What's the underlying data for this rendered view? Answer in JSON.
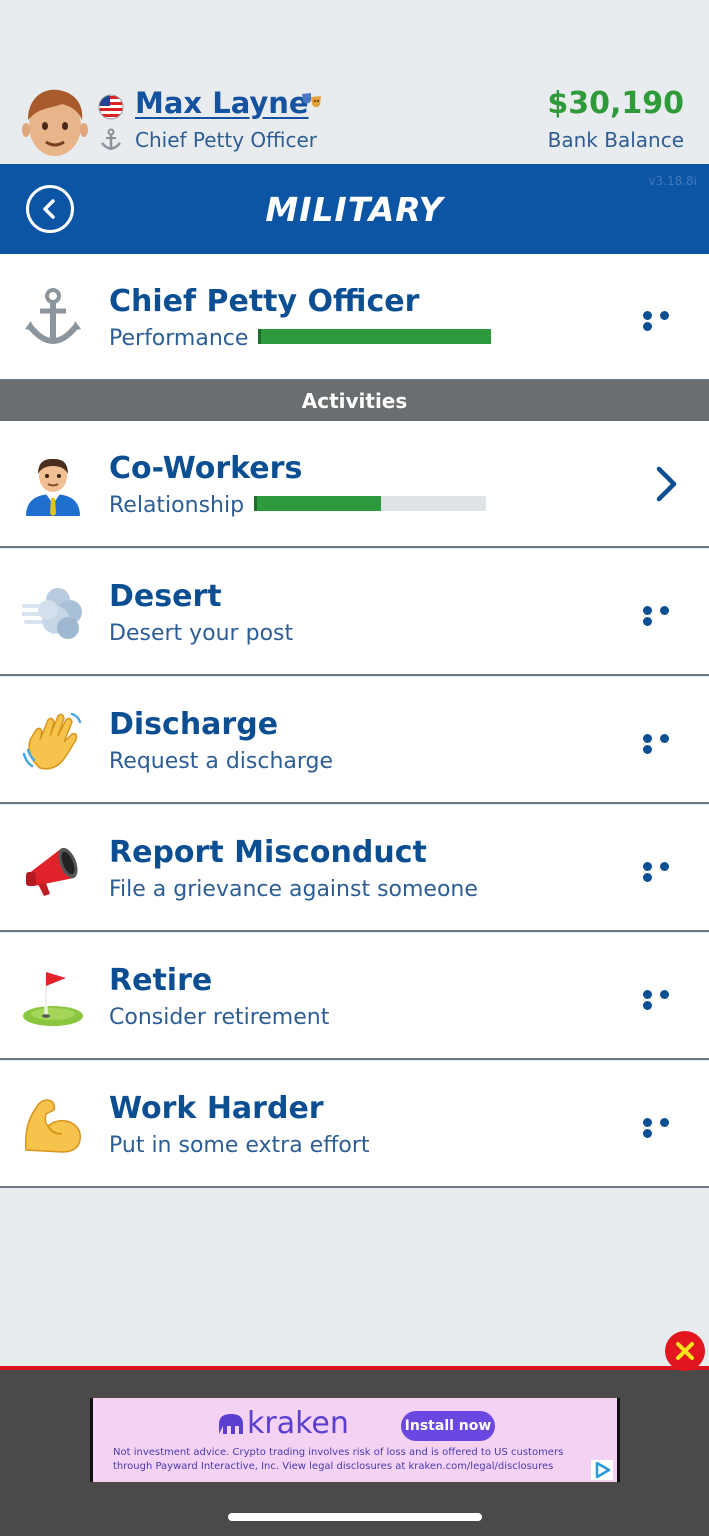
{
  "header": {
    "name": "Max Layne",
    "job_title": "Chief Petty Officer",
    "balance": "$30,190",
    "balance_label": "Bank Balance"
  },
  "titlebar": {
    "title": "MILITARY",
    "version": "v3.18.8i"
  },
  "job": {
    "title": "Chief Petty Officer",
    "label": "Performance",
    "performance": 1.0
  },
  "section": {
    "label": "Activities"
  },
  "activities": [
    {
      "title": "Co-Workers",
      "subtitle": "Relationship",
      "icon": "man-office-worker-icon",
      "relationship": 0.54
    },
    {
      "title": "Desert",
      "subtitle": "Desert your post",
      "icon": "dash-cloud-icon"
    },
    {
      "title": "Discharge",
      "subtitle": "Request a discharge",
      "icon": "waving-hand-icon"
    },
    {
      "title": "Report Misconduct",
      "subtitle": "File a grievance against someone",
      "icon": "megaphone-icon"
    },
    {
      "title": "Retire",
      "subtitle": "Consider retirement",
      "icon": "golf-flag-icon"
    },
    {
      "title": "Work Harder",
      "subtitle": "Put in some extra effort",
      "icon": "flexed-biceps-icon"
    }
  ],
  "ad": {
    "brand": "kraken",
    "cta": "Install now",
    "disclaimer_1": "Not investment advice. Crypto trading involves risk of loss and is offered to US customers",
    "disclaimer_2": "through Payward Interactive, Inc. View legal disclosures at kraken.com/legal/disclosures"
  },
  "colors": {
    "accent": "#0b55a4",
    "money": "#2f9a3a",
    "ad_close": "#e3161f"
  }
}
